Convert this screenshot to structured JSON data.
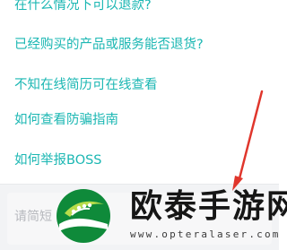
{
  "faq": {
    "items": [
      {
        "label": "在什么情况下可以退款?"
      },
      {
        "label": "已经购买的产品或服务能否退货?"
      },
      {
        "label": "不知在线简历可在线查看"
      },
      {
        "label": "如何查看防骗指南"
      },
      {
        "label": "如何举报BOSS"
      }
    ]
  },
  "input": {
    "placeholder": "请简短"
  },
  "watermark": {
    "title": "欧泰手游网",
    "url": "www.opteralaser.com"
  },
  "colors": {
    "link": "#1bb7b3",
    "arrow": "#e0362c",
    "input_bg": "#f2f3f5",
    "logo_green": "#0f8a3a"
  },
  "icons": [
    "leaf-logo-icon",
    "annotation-arrow-icon"
  ]
}
